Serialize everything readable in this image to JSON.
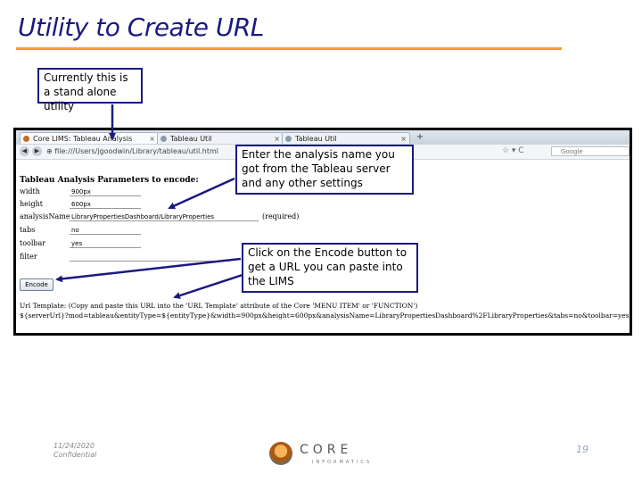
{
  "slide": {
    "title": "Utility to Create URL",
    "footer_date": "11/24/2020",
    "footer_conf": "Confidential",
    "page_number": "19",
    "accent_color": "#f0a030",
    "title_color": "#1a1a80"
  },
  "callouts": [
    {
      "text": "Currently this is a stand alone utility"
    },
    {
      "text": "Enter the analysis name you got from the Tableau server and any other settings"
    },
    {
      "text": "Click on the Encode button to get a URL you can paste into the LIMS"
    }
  ],
  "logo": {
    "word": "CORE",
    "sub": "INFORMATICS"
  },
  "browser": {
    "tabs": [
      {
        "label": "Core LIMS: Tableau Analysis"
      },
      {
        "label": "Tableau Util"
      },
      {
        "label": "Tableau Util"
      }
    ],
    "tab_close": "×",
    "tab_add": "+",
    "nav_back": "◀",
    "nav_fwd": "▶",
    "url": "⊕ file:///Users/jgoodwin/Library/tableau/util.html",
    "nav_right": "☆ ▾ C",
    "search_placeholder": "Google"
  },
  "form": {
    "heading": "Tableau Analysis Parameters to encode:",
    "fields": [
      {
        "label": "width",
        "value": "900px"
      },
      {
        "label": "height",
        "value": "600px"
      },
      {
        "label": "analysisName",
        "value": "LibraryPropertiesDashboard/LibraryProperties",
        "required": "(required)"
      },
      {
        "label": "tabs",
        "value": "no"
      },
      {
        "label": "toolbar",
        "value": "yes"
      },
      {
        "label": "filter",
        "value": ""
      }
    ],
    "encode_label": "Encode",
    "output_line1": "Url Template: (Copy and paste this URL into the 'URL Template' attribute of the Core 'MENU ITEM' or 'FUNCTION')",
    "output_line2": "${serverUrl}?mod=tableau&entityType=${entityType}&width=900px&height=600px&analysisName=LibraryPropertiesDashboard%2FLibraryProperties&tabs=no&toolbar=yes&filter="
  }
}
